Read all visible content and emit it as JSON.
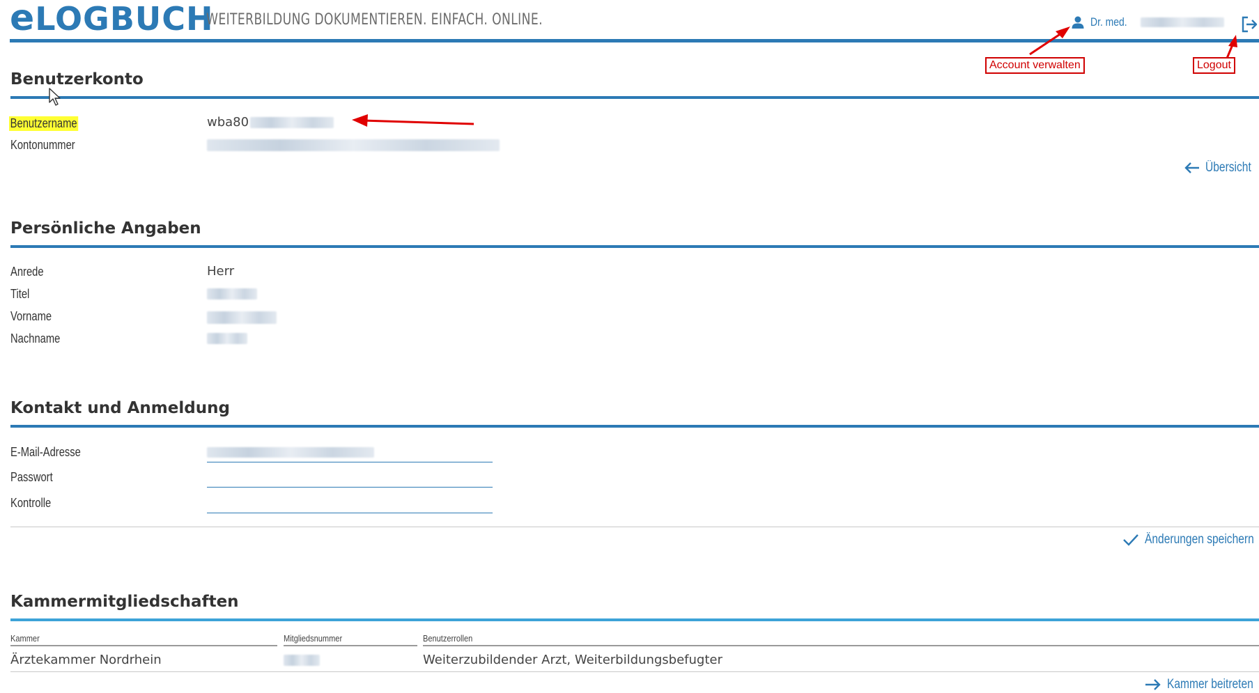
{
  "header": {
    "logo_e": "e",
    "logo_rest": "LOGBUCH",
    "tagline": "WEITERBILDUNG DOKUMENTIEREN. EINFACH. ONLINE.",
    "user_prefix": "Dr. med.",
    "brand_color": "#2c7ab5"
  },
  "annotations": {
    "account": "Account verwalten",
    "logout": "Logout"
  },
  "benutzerkonto": {
    "title": "Benutzerkonto",
    "username_label": "Benutzername",
    "username_value": "wba80",
    "account_label": "Kontonummer",
    "overview_link": "Übersicht"
  },
  "personal": {
    "title": "Persönliche Angaben",
    "anrede_label": "Anrede",
    "anrede_value": "Herr",
    "titel_label": "Titel",
    "vorname_label": "Vorname",
    "nachname_label": "Nachname"
  },
  "contact": {
    "title": "Kontakt und Anmeldung",
    "email_label": "E-Mail-Adresse",
    "password_label": "Passwort",
    "control_label": "Kontrolle",
    "save_link": "Änderungen speichern"
  },
  "chambers": {
    "title": "Kammermitgliedschaften",
    "columns": [
      "Kammer",
      "Mitgliedsnummer",
      "Benutzerrollen"
    ],
    "rows": [
      {
        "kammer": "Ärztekammer Nordrhein",
        "roles": "Weiterzubildender Arzt, Weiterbildungsbefugter"
      }
    ],
    "join_link": "Kammer beitreten"
  }
}
